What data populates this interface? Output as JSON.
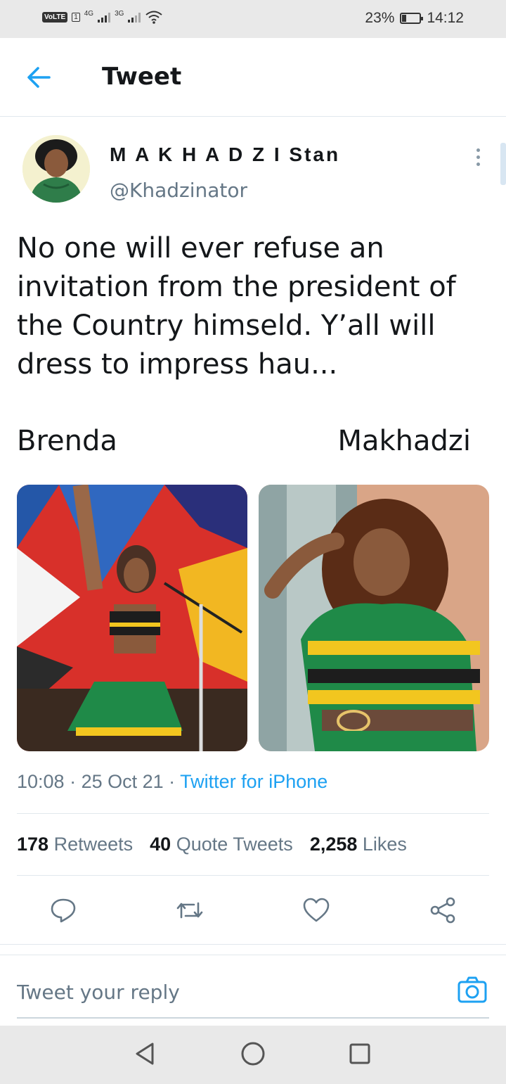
{
  "status_bar": {
    "volte": "VoLTE",
    "sim": "1",
    "net1": "4G",
    "net2": "3G",
    "battery": "23%",
    "battery_level": 0.23,
    "time": "14:12"
  },
  "header": {
    "title": "Tweet",
    "back_icon": "arrow-left-icon"
  },
  "tweet": {
    "author": {
      "name": "M A K H A D Z I Stan",
      "handle": "@Khadzinator"
    },
    "text": "No one will ever refuse an\ninvitation from the president of\nthe Country himseld. Y’all will\ndress to impress hau...",
    "captions": {
      "left": "Brenda",
      "right": "Makhadzi"
    },
    "meta": {
      "time": "10:08",
      "separator": " · ",
      "date": "25 Oct 21",
      "source": "Twitter for iPhone"
    },
    "stats": {
      "retweets_count": "178",
      "retweets_label": "Retweets",
      "quotes_count": "40",
      "quotes_label": "Quote Tweets",
      "likes_count": "2,258",
      "likes_label": "Likes"
    }
  },
  "actions": [
    "reply-icon",
    "retweet-icon",
    "like-icon",
    "share-icon"
  ],
  "composer": {
    "placeholder": "Tweet your reply"
  },
  "colors": {
    "accent": "#1da1f2",
    "text": "#14171a",
    "muted": "#657786",
    "divider": "#e1e8ed"
  }
}
